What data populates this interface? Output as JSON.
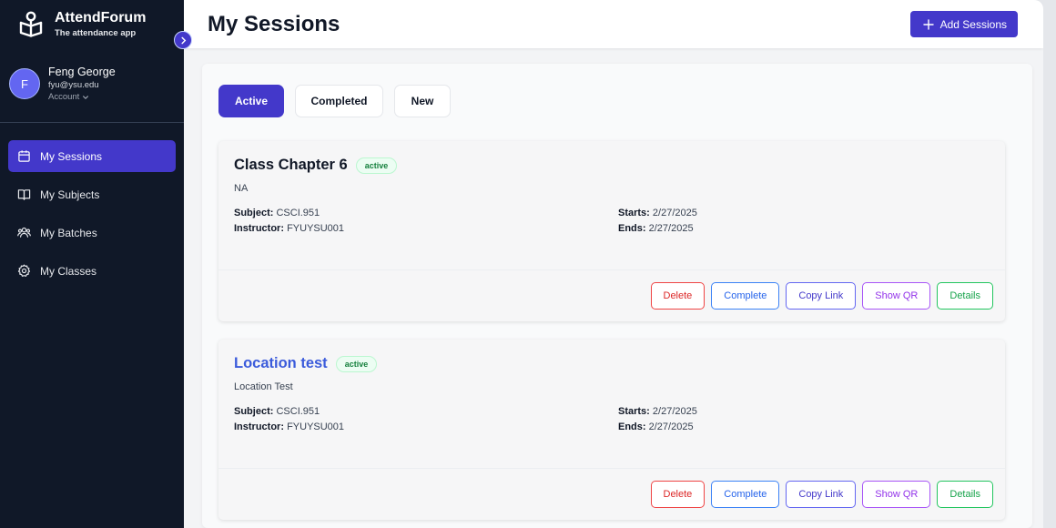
{
  "app": {
    "name": "AttendForum",
    "tagline": "The attendance app"
  },
  "user": {
    "initial": "F",
    "name": "Feng George",
    "email": "fyu@ysu.edu",
    "account_label": "Account"
  },
  "nav": [
    {
      "label": "My Sessions",
      "icon": "calendar-icon",
      "active": true
    },
    {
      "label": "My Subjects",
      "icon": "book-icon",
      "active": false
    },
    {
      "label": "My Batches",
      "icon": "users-icon",
      "active": false
    },
    {
      "label": "My Classes",
      "icon": "gear-icon",
      "active": false
    }
  ],
  "header": {
    "title": "My Sessions",
    "add_button": "Add Sessions"
  },
  "tabs": [
    {
      "label": "Active",
      "active": true
    },
    {
      "label": "Completed",
      "active": false
    },
    {
      "label": "New",
      "active": false
    }
  ],
  "labels": {
    "subject": "Subject:",
    "instructor": "Instructor:",
    "starts": "Starts:",
    "ends": "Ends:"
  },
  "sessions": [
    {
      "title": "Class Chapter 6",
      "status": "active",
      "description": "NA",
      "subject": "CSCI.951",
      "instructor": "FYUYSU001",
      "starts": "2/27/2025",
      "ends": "2/27/2025"
    },
    {
      "title": "Location test",
      "status": "active",
      "description": "Location Test",
      "subject": "CSCI.951",
      "instructor": "FYUYSU001",
      "starts": "2/27/2025",
      "ends": "2/27/2025"
    }
  ],
  "actions": {
    "delete": "Delete",
    "complete": "Complete",
    "copy_link": "Copy Link",
    "show_qr": "Show QR",
    "details": "Details"
  },
  "colors": {
    "sidebar_bg": "#101828",
    "accent": "#4338ca",
    "active_badge": "#15803d",
    "link_title": "#3b5bdb"
  }
}
